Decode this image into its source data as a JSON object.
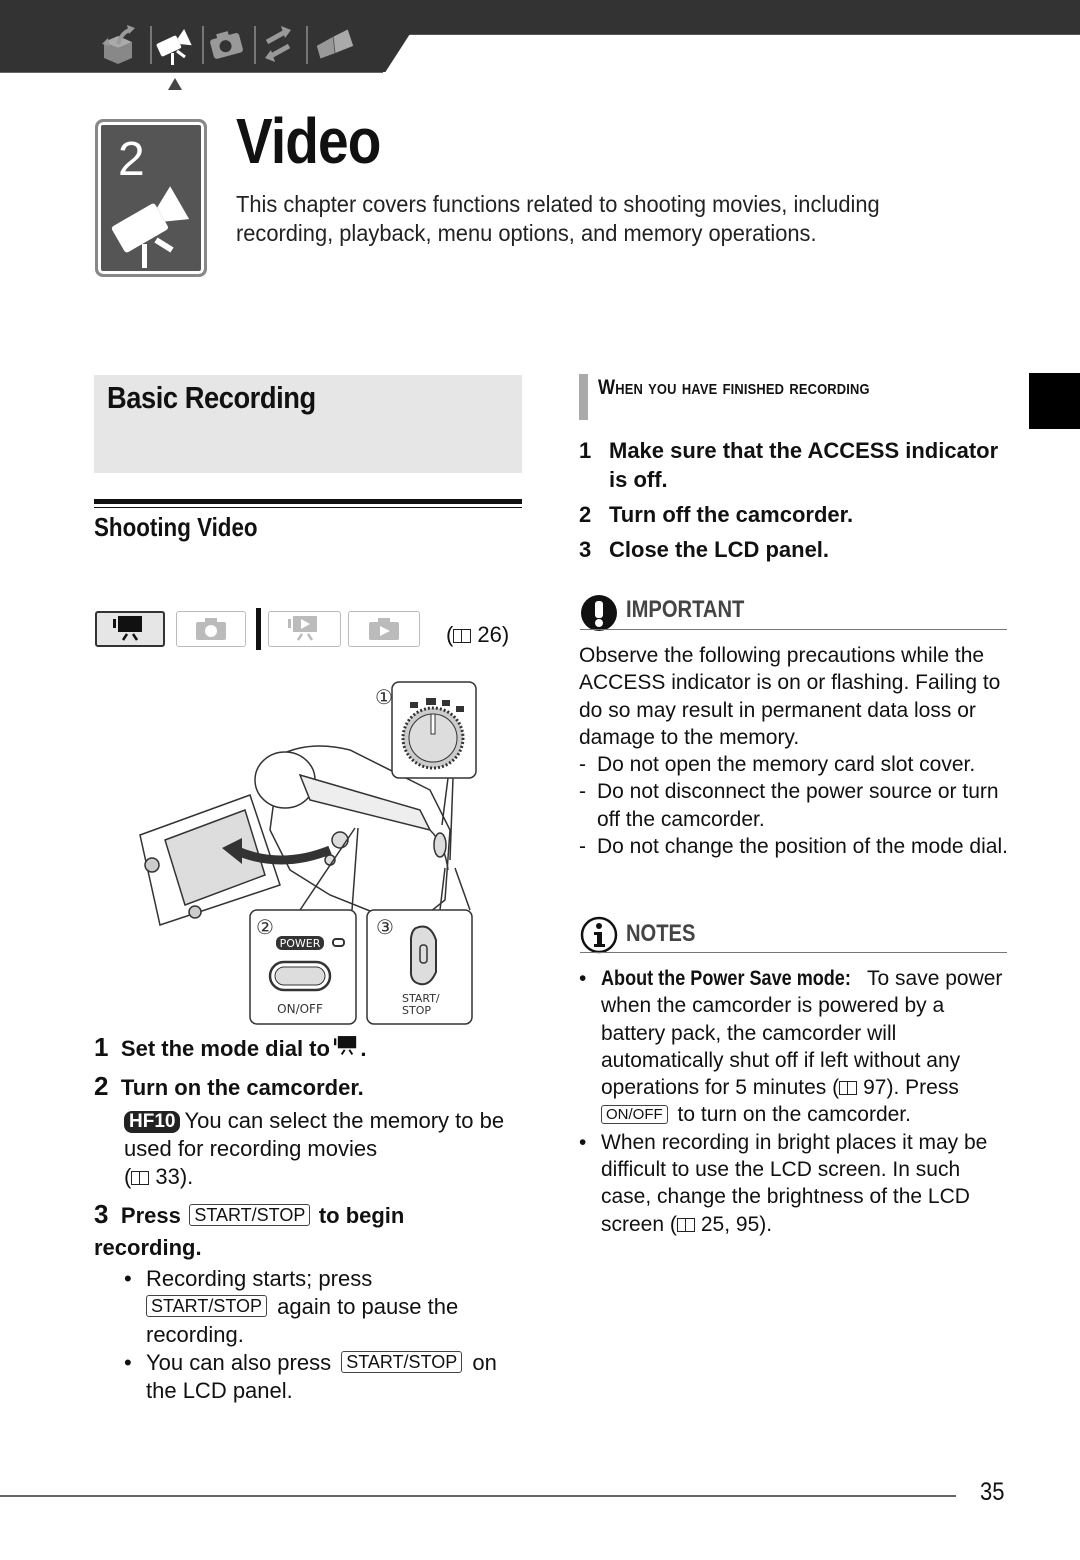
{
  "header": {
    "nav_icons": [
      {
        "name": "introduction",
        "icon": "open-box-icon",
        "active": false
      },
      {
        "name": "video",
        "icon": "video-camera-icon",
        "active": true
      },
      {
        "name": "photos",
        "icon": "camera-icon",
        "active": false
      },
      {
        "name": "external-connections",
        "icon": "arrows-icon",
        "active": false
      },
      {
        "name": "additional-information",
        "icon": "book-icon",
        "active": false
      }
    ]
  },
  "chapter": {
    "number": "2",
    "title": "Video",
    "description": "This chapter covers functions related to shooting movies, including recording, playback, menu options, and memory operations."
  },
  "section": {
    "title": "Basic Recording",
    "subsection_title": "Shooting Video"
  },
  "modes": {
    "buttons": [
      {
        "name": "video-record",
        "icon": "movie-camera-icon",
        "active": true
      },
      {
        "name": "photo-record",
        "icon": "camera-icon",
        "active": false
      },
      {
        "name": "video-playback",
        "icon": "movie-playback-icon",
        "active": false
      },
      {
        "name": "photo-playback",
        "icon": "photo-playback-icon",
        "active": false
      }
    ],
    "reference_page": "26",
    "reference_prefix": "(",
    "reference_suffix": ")"
  },
  "illustration": {
    "callout_1": "①",
    "callout_2": "②",
    "callout_3": "③",
    "power_label": "POWER",
    "on_off_label": "ON/OFF",
    "start_stop_label_1": "START/",
    "start_stop_label_2": "STOP"
  },
  "steps": [
    {
      "number": "1",
      "text": "Set the mode dial to",
      "suffix": "."
    },
    {
      "number": "2",
      "text": "Turn on the camcorder.",
      "note_badge": "HF10",
      "note": "You can select the memory to be used for recording movies",
      "note_ref": "33",
      "note_end": ")."
    },
    {
      "number": "3",
      "text_before": "Press",
      "key": "START/STOP",
      "text_after": "to begin recording.",
      "bullets": [
        {
          "before": "Recording starts; press",
          "key": "START/STOP",
          "after": "again to pause the recording."
        },
        {
          "before": "You can also press",
          "key": "START/STOP",
          "after": "on the LCD panel."
        }
      ]
    }
  ],
  "finish": {
    "title": "When you have finished recording",
    "steps": [
      {
        "number": "1",
        "text": "Make sure that the ACCESS indicator is off."
      },
      {
        "number": "2",
        "text": "Turn off the camcorder."
      },
      {
        "number": "3",
        "text": "Close the LCD panel."
      }
    ]
  },
  "important": {
    "title": "IMPORTANT",
    "intro": "Observe the following precautions while the ACCESS indicator is on or flashing. Failing to do so may result in permanent data loss or damage to the memory.",
    "items": [
      "Do not open the memory card slot cover.",
      "Do not disconnect the power source or turn off the camcorder.",
      "Do not change the position of the mode dial."
    ]
  },
  "notes": {
    "title": "NOTES",
    "items": [
      {
        "bold": "About the Power Save mode:",
        "text": "To save power when the camcorder is powered by a battery pack, the camcorder will automatically shut off if left without any operations for 5 minutes (",
        "ref": "97",
        "text2": "). Press",
        "key": "ON/OFF",
        "text3": "to turn on the camcorder."
      },
      {
        "text": "When recording in bright places it may be difficult to use the LCD screen. In such case, change the brightness of the LCD screen (",
        "ref": "25, 95",
        "text2": ")."
      }
    ]
  },
  "footer": {
    "page_number": "35"
  }
}
